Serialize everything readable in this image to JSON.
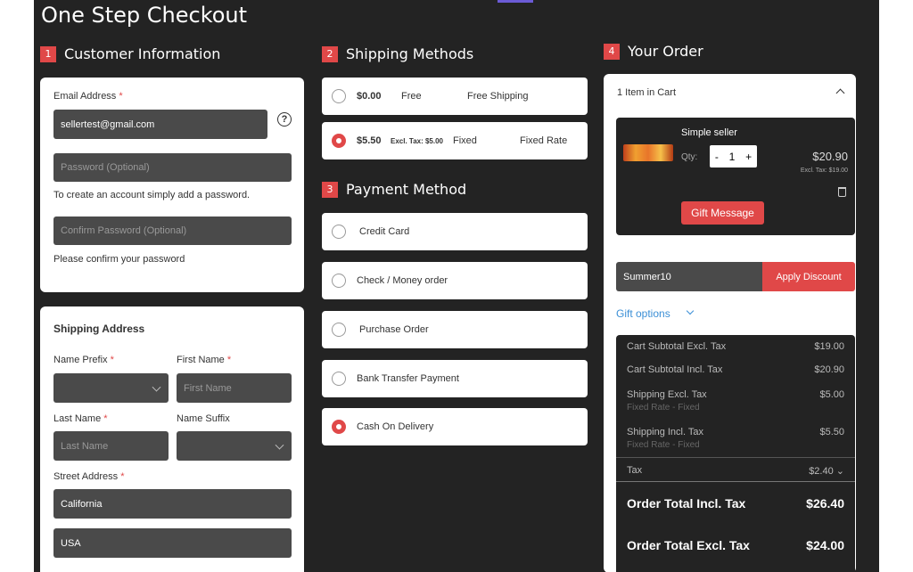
{
  "page_title": "One Step Checkout",
  "customer": {
    "num": "1",
    "heading": "Customer Information",
    "email_label": "Email Address",
    "email_value": "sellertest@gmail.com",
    "help": "?",
    "password_placeholder": "Password (Optional)",
    "password_hint": "To create an account simply add a password.",
    "confirm_placeholder": "Confirm Password (Optional)",
    "confirm_hint": "Please confirm your password"
  },
  "shipping_address": {
    "heading": "Shipping Address",
    "name_prefix_label": "Name Prefix",
    "first_name_label": "First Name",
    "first_name_placeholder": "First Name",
    "last_name_label": "Last Name",
    "last_name_placeholder": "Last Name",
    "name_suffix_label": "Name Suffix",
    "street_label": "Street Address",
    "street_1": "California",
    "street_2": "USA",
    "required_mark": "*"
  },
  "shipping_methods": {
    "num": "2",
    "heading": "Shipping Methods",
    "options": [
      {
        "price": "$0.00",
        "excl": "",
        "method": "Free",
        "carrier": "Free Shipping",
        "selected": false
      },
      {
        "price": "$5.50",
        "excl": "Excl. Tax: $5.00",
        "method": "Fixed",
        "carrier": "Fixed Rate",
        "selected": true
      }
    ]
  },
  "payment": {
    "num": "3",
    "heading": "Payment Method",
    "options": [
      {
        "label": "Credit Card",
        "selected": false
      },
      {
        "label": "Check / Money order",
        "selected": false
      },
      {
        "label": "Purchase Order",
        "selected": false
      },
      {
        "label": "Bank Transfer Payment",
        "selected": false
      },
      {
        "label": "Cash On Delivery",
        "selected": true
      }
    ]
  },
  "order": {
    "num": "4",
    "heading": "Your Order",
    "items_in_cart": "1 Item in Cart",
    "product_name": "Simple seller",
    "qty_label": "Qty:",
    "qty": "1",
    "minus": "-",
    "plus": "+",
    "price": "$20.90",
    "price_excl": "Excl. Tax: $19.00",
    "gift_message": "Gift Message",
    "discount_code": "Summer10",
    "apply_discount": "Apply Discount",
    "gift_options": "Gift options",
    "totals": [
      {
        "label": "Cart Subtotal Excl. Tax",
        "value": "$19.00"
      },
      {
        "label": "Cart Subtotal Incl. Tax",
        "value": "$20.90"
      },
      {
        "label": "Shipping Excl. Tax",
        "value": "$5.00",
        "sub": "Fixed Rate - Fixed"
      },
      {
        "label": "Shipping Incl. Tax",
        "value": "$5.50",
        "sub": "Fixed Rate - Fixed"
      },
      {
        "label": "Tax",
        "value": "$2.40"
      }
    ],
    "grand_incl_label": "Order Total Incl. Tax",
    "grand_incl_value": "$26.40",
    "grand_excl_label": "Order Total Excl. Tax",
    "grand_excl_value": "$24.00"
  },
  "colors": {
    "accent": "#e04848",
    "dark": "#232323",
    "link": "#3b8fd6"
  }
}
